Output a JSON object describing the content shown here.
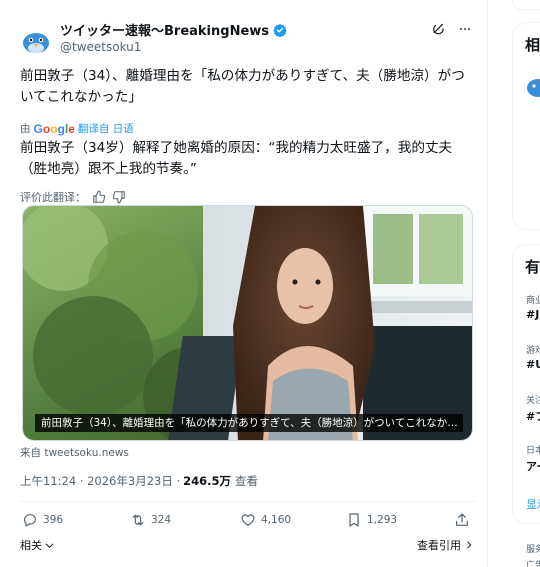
{
  "tweet": {
    "display_name": "ツイッター速報〜BreakingNews",
    "handle": "@tweetsoku1",
    "text_original": "前田敦子（34）、離婚理由を「私の体力がありすぎて、夫（勝地涼）がついてこれなかった」",
    "translated_by_prefix": "由",
    "translated_by_brand": "Google",
    "translated_by_suffix": "翻译自 日语",
    "text_translated": "前田敦子（34岁）解释了她离婚的原因：“我的精力太旺盛了，我的丈夫（胜地亮）跟不上我的节奏。”",
    "rate_translation": "评价此翻译：",
    "media_caption": "前田敦子（34）、離婚理由を「私の体力がありすぎて、夫（勝地涼）がついてこれなか…",
    "source": "来自 tweetsoku.news",
    "time": "上午11:24 · 2026年3月23日 · ",
    "views": "246.5万",
    "views_label": "查看",
    "counts": {
      "replies": "396",
      "retweets": "324",
      "likes": "4,160",
      "bookmarks": "1,293"
    },
    "related_label": "相关",
    "quotes_label": "查看引用"
  },
  "right_sidebar": {
    "heading_1": "相",
    "heading_2": "有",
    "trends": [
      {
        "category": "商业",
        "tag": "#J"
      },
      {
        "category": "游戏",
        "tag": "#U"
      },
      {
        "category": "关注",
        "tag": "#フ"
      },
      {
        "category": "日本",
        "tag": "アー"
      }
    ],
    "show_more": "显示",
    "footer_1": "服务",
    "footer_2": "广告"
  },
  "colors": {
    "accent": "#1d9bf0",
    "muted": "#536471",
    "text": "#0f1419"
  },
  "icons": [
    "avatar-bird-icon",
    "verified-badge-icon",
    "grok-icon",
    "more-icon",
    "thumbs-up-icon",
    "thumbs-down-icon",
    "reply-icon",
    "retweet-icon",
    "like-icon",
    "bookmark-icon",
    "share-icon",
    "chevron-down-icon",
    "chevron-right-icon"
  ]
}
